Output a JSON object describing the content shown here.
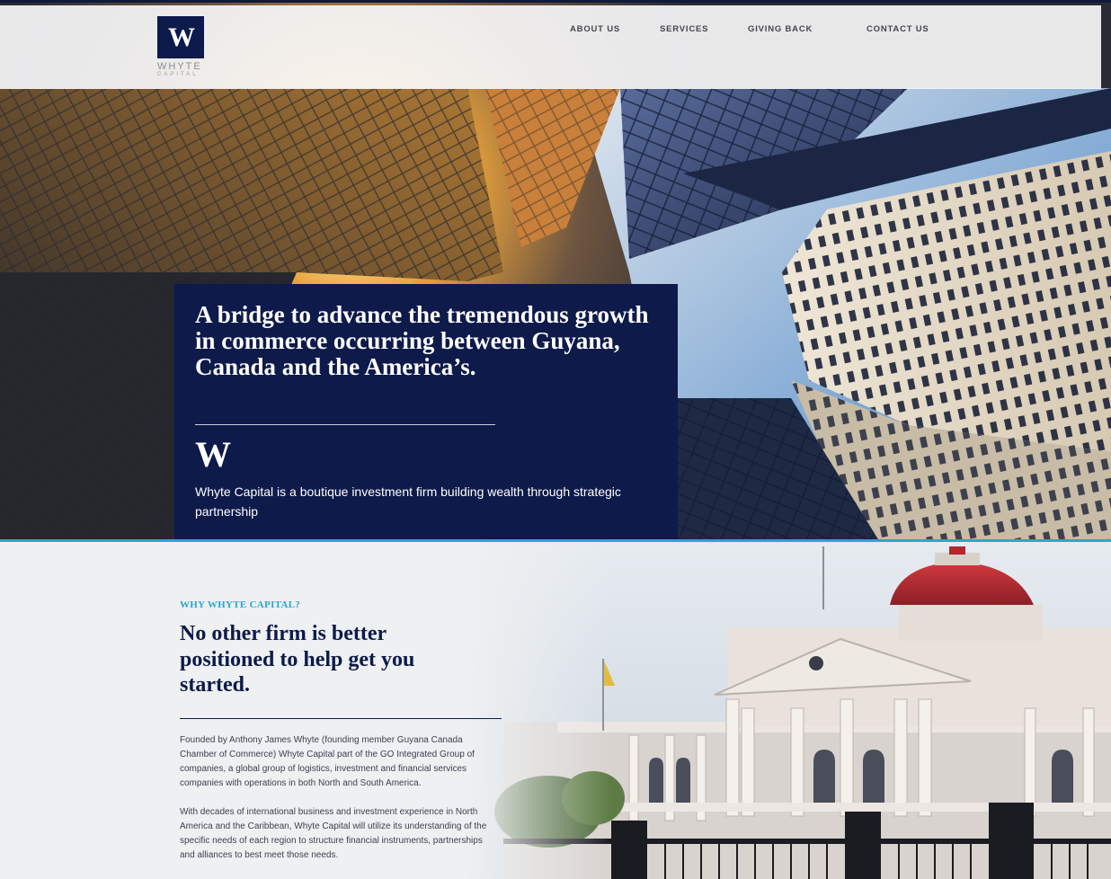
{
  "brand": {
    "logo_mark": "W",
    "logo_word": "WHYTE",
    "logo_sub": "CAPITAL",
    "primary_color": "#0d1a4a",
    "accent_color": "#2aa6d6"
  },
  "nav": {
    "items": [
      {
        "label": "ABOUT US"
      },
      {
        "label": "SERVICES"
      },
      {
        "label": "GIVING BACK"
      },
      {
        "label": "CONTACT US"
      }
    ]
  },
  "hero": {
    "heading": "A bridge to advance the tremendous growth in commerce occurring between Guyana, Canada and the America’s.",
    "mark": "W",
    "description": "Whyte Capital is a boutique investment firm building wealth through strategic partnership"
  },
  "why": {
    "label": "WHY WHYTE CAPITAL?",
    "heading": "No other firm is better positioned to help get you started.",
    "paragraphs": [
      "Founded by Anthony James Whyte (founding member Guyana Canada Chamber of Commerce) Whyte Capital part of the GO Integrated Group of companies, a global group of logistics, investment and financial services companies with operations in both North and South America.",
      "With decades of international business and investment experience in North America and the Caribbean, Whyte Capital will utilize its understanding of the specific needs of each region to structure financial instruments, partnerships and alliances to best meet those needs."
    ]
  }
}
